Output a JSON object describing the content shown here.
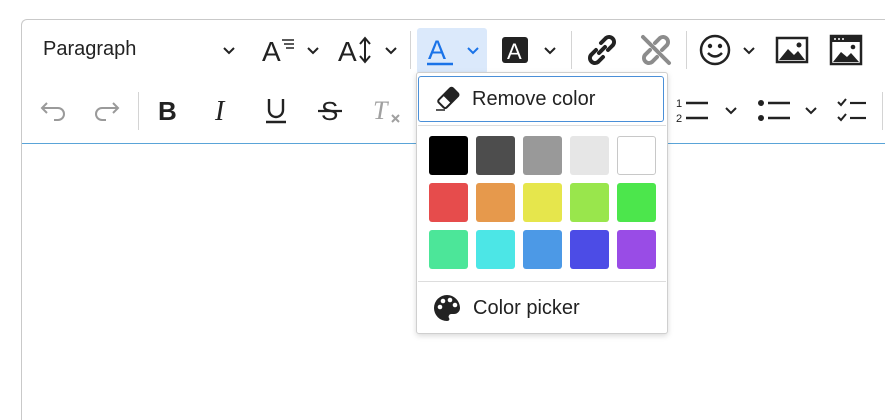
{
  "toolbar": {
    "heading_select": {
      "value": "Paragraph"
    },
    "row1_icons": [
      "font-size-icon",
      "line-height-icon",
      "font-color-icon",
      "background-color-icon",
      "link-icon",
      "unlink-icon",
      "emoji-icon",
      "image-icon",
      "media-icon"
    ],
    "row2_icons": [
      "undo-icon",
      "redo-icon",
      "bold-icon",
      "italic-icon",
      "underline-icon",
      "strikethrough-icon",
      "clear-formatting-icon",
      "numbered-list-icon",
      "bulleted-list-icon",
      "checklist-icon"
    ]
  },
  "color_dropdown": {
    "remove_label": "Remove color",
    "picker_label": "Color picker",
    "swatches": [
      [
        "#000000",
        "#4d4d4d",
        "#999999",
        "#e6e6e6",
        "#ffffff"
      ],
      [
        "#e64c4c",
        "#e6994c",
        "#e6e64c",
        "#99e64c",
        "#4ce64c"
      ],
      [
        "#4ce699",
        "#4ce6e6",
        "#4c99e6",
        "#4c4ce6",
        "#994ce6"
      ]
    ]
  },
  "colors": {
    "accent": "#1a73e8",
    "active_bg": "#dbe9fb"
  }
}
